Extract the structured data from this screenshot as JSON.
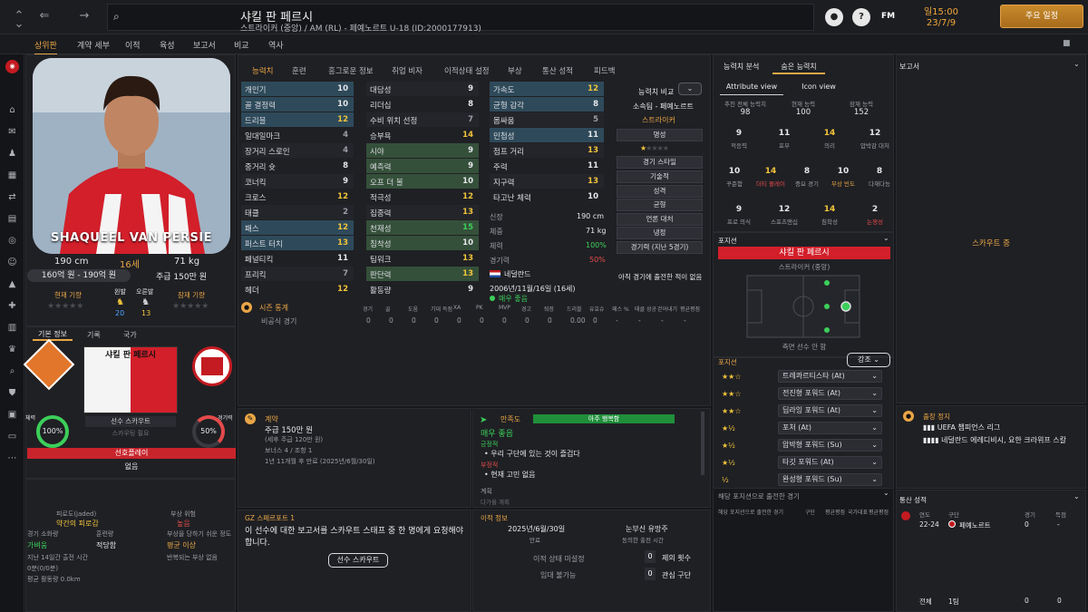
{
  "top": {
    "name": "샤킬 판 페르시",
    "sub": "스트라이커 (중앙) / AM (RL) - 페예노르트 U-18 (ID:2000177913)",
    "time": "일15:00",
    "date": "23/7/9",
    "main_btn": "주요 일정",
    "fm": "FM"
  },
  "menu": [
    "상위판",
    "계약 세부",
    "이적",
    "육성",
    "보고서",
    "비교",
    "역사"
  ],
  "player": {
    "photo_name": "SHAQUEEL VAN PERSIE",
    "height": "190 cm",
    "age": "16세",
    "weight": "71 kg",
    "value": "160억 원 - 190억 원",
    "wage": "주급 150만 원",
    "current_label": "현재 기량",
    "potential_label": "잠재 기량",
    "left_foot_label": "왼발",
    "right_foot_label": "오른발",
    "left_foot": "20",
    "right_foot": "13"
  },
  "left_tabs": [
    "기본 정보",
    "기록",
    "국가"
  ],
  "card": {
    "name": "샤킬 판 페르시",
    "scout_label": "선수 스카우트",
    "scout_needed": "스카우팅 필요",
    "fitness_label": "체력",
    "fitness": "100%",
    "sharp_label": "경기력",
    "sharp": "50%",
    "role_badge": "선호플레이",
    "role_none": "없음"
  },
  "left_bottom": {
    "jaded": "피로도(jaded)",
    "jaded_val": "약간의 피로감",
    "injury_risk": "부상 위험",
    "injury_val": "높음",
    "condition": "경기 소화량",
    "condition_val": "가벼움",
    "training": "훈련량",
    "training_val": "적당함",
    "injury_prone": "부상을 당하기 쉬운 정도",
    "injury_prone_val": "평균 이상",
    "mins14": "지난 14일간 출전 시간",
    "mins14_val": "0분(0/0분)",
    "avg_dist": "평균 활동량 0.0km",
    "repeat": "반복되는 부상 없음"
  },
  "attr_tabs": [
    "능력치",
    "훈련",
    "흥그로운 정보",
    "취업 비자",
    "이적상태 설정",
    "부상",
    "통산 성적",
    "피드백"
  ],
  "attrs": {
    "col1": [
      [
        "개인기",
        "10"
      ],
      [
        "골 결정력",
        "10"
      ],
      [
        "드리블",
        "12"
      ],
      [
        "일대일마크",
        "4"
      ],
      [
        "장거리 스로인",
        "4"
      ],
      [
        "중거리 슛",
        "8"
      ],
      [
        "코너킥",
        "9"
      ],
      [
        "크로스",
        "12"
      ],
      [
        "태클",
        "2"
      ],
      [
        "패스",
        "12"
      ],
      [
        "퍼스트 터치",
        "13"
      ],
      [
        "페널티킥",
        "11"
      ],
      [
        "프리킥",
        "7"
      ],
      [
        "헤더",
        "12"
      ]
    ],
    "col2": [
      [
        "대담성",
        "9"
      ],
      [
        "리더십",
        "8"
      ],
      [
        "수비 위치 선정",
        "7"
      ],
      [
        "승부욕",
        "14"
      ],
      [
        "시야",
        "9"
      ],
      [
        "예측력",
        "9"
      ],
      [
        "오프 더 볼",
        "10"
      ],
      [
        "적극성",
        "12"
      ],
      [
        "집중력",
        "13"
      ],
      [
        "천재성",
        "15"
      ],
      [
        "침착성",
        "10"
      ],
      [
        "팀워크",
        "13"
      ],
      [
        "판단력",
        "13"
      ],
      [
        "활동량",
        "9"
      ]
    ],
    "col3": [
      [
        "가속도",
        "12"
      ],
      [
        "균형 감각",
        "8"
      ],
      [
        "몸싸움",
        "5"
      ],
      [
        "민첩성",
        "11"
      ],
      [
        "점프 거리",
        "13"
      ],
      [
        "주력",
        "11"
      ],
      [
        "지구력",
        "13"
      ],
      [
        "타고난 체력",
        "10"
      ]
    ]
  },
  "physical": {
    "height_lbl": "신장",
    "height": "190 cm",
    "weight_lbl": "체중",
    "weight": "71 kg",
    "fitness_lbl": "체력",
    "fitness": "100%",
    "sharp_lbl": "경기력",
    "sharp": "50%",
    "nation_lbl": "국적",
    "nation": "네덜란드",
    "dob": "2006년/11월/16일 (16세)",
    "morale_lbl": "사기",
    "morale": "매우 좋음"
  },
  "compare": {
    "title": "능력치 비교",
    "club": "소속팀 - 페예노르트",
    "role": "스트라이커",
    "rep_btn": "명성",
    "style_btn": "경기 스타일",
    "tech_btn": "기술적",
    "mental_btn": "정신적",
    "phys_btn": "균형",
    "mental2_btn": "성격",
    "rec_btn": "언론 대처",
    "cool_btn": "냉정",
    "last5_btn": "경기력 (지난 5경기)",
    "none": "아직 경기에 출전한 적이 없음"
  },
  "season": {
    "title": "시즌 통계",
    "cols": [
      "경기",
      "골",
      "도움",
      "기대 득점",
      "XA",
      "PK",
      "MVP",
      "경고",
      "퇴장",
      "드리블",
      "유효슈",
      "패스 %",
      "태클 성공",
      "걷어내기",
      "평균평점"
    ],
    "row_label": "비공식 경기",
    "row_vals": [
      "0",
      "0",
      "0",
      "0",
      "0",
      "0",
      "0",
      "0",
      "0",
      "0.00",
      "0",
      "-",
      "-",
      "-",
      "-"
    ]
  },
  "contract": {
    "title": "계약",
    "wage": "주급 150만 원",
    "detail": "(세후 주급 120만 원)",
    "bonus": "보너스 4 / 조항 1",
    "expiry": "1년 11개월 후 만료 (2025년/6월/30일)"
  },
  "happiness": {
    "title": "만족도",
    "bar": "아주 행복함",
    "status": "매우 좋음",
    "pos_lbl": "긍정적",
    "pos": "우리 구단에 있는 것이 즐겁다",
    "neg_lbl": "부정적",
    "neg": "현재 고민 없음",
    "plan_lbl": "계획",
    "plan": "다가올 계획"
  },
  "scout_report": {
    "title": "스페르포트 1",
    "text": "이 선수에 대한 보고서를 스카우트 스태프 중 한 명에게 요청해야 합니다.",
    "btn": "선수 스카우트"
  },
  "transfer": {
    "title": "이적 정보",
    "date": "2025년/6월/30일",
    "date_lbl": "만료",
    "status": "눈부신 유망주",
    "status_lbl": "동의한 출전 시간",
    "transfer_status": "이적 상태 미설정",
    "loan_status": "임대 불가능",
    "offers_lbl": "제의 횟수",
    "offers": "0",
    "interest_lbl": "관심 구단",
    "interest": "0"
  },
  "analysis": {
    "tabs": [
      "능력치 분석",
      "숨은 능력치"
    ],
    "views": [
      "Attribute view",
      "Icon view"
    ],
    "ca_lbl": "추천 전체 능력치",
    "ca": "98",
    "cur_lbl": "현재 능력",
    "cur": "100",
    "pa_lbl": "잠재 능력",
    "pa": "152",
    "hidden": [
      [
        "9",
        "적응력"
      ],
      [
        "11",
        "포부"
      ],
      [
        "14",
        "의리"
      ],
      [
        "12",
        "압박감 대처"
      ],
      [
        "10",
        "꾸준함"
      ],
      [
        "14",
        "더티 플레이"
      ],
      [
        "8",
        "중요 경기"
      ],
      [
        "10",
        "부상 빈도"
      ],
      [
        "8",
        "다재다능"
      ],
      [
        "9",
        "프로 의식"
      ],
      [
        "12",
        "스포츠맨십"
      ],
      [
        "14",
        "침착성"
      ],
      [
        "2",
        "논쟁성"
      ]
    ]
  },
  "position": {
    "title": "포지션",
    "role": "샤킬 판 페르시",
    "role_sub": "스트라이커 (중앙)",
    "caption": "측면 선수 안 함"
  },
  "roles": {
    "title": "포지션",
    "emph": "강조",
    "list": [
      [
        "★★☆",
        "트레콰르티스타 (At)"
      ],
      [
        "★★☆",
        "전진형 포워드 (At)"
      ],
      [
        "★★☆",
        "딥라잉 포워드 (At)"
      ],
      [
        "★½",
        "포처 (At)"
      ],
      [
        "★½",
        "압박형 포워드 (Su)"
      ],
      [
        "★½",
        "타깃 포워드 (At)"
      ],
      [
        "½",
        "완성형 포워드 (Su)"
      ]
    ],
    "played": "해당 포지션으로 출전한 경기",
    "played_cols": [
      "해당 포지션으로 출전한 경기",
      "구단",
      "평균평점",
      "국가대표",
      "평균평점"
    ]
  },
  "report": {
    "title": "보고서",
    "status": "스카우트 중"
  },
  "trips": {
    "title": "출장 정지",
    "a": "UEFA 챔피언스 리그",
    "b": "네덜란드 에레디비시, 요한 크라위프 스칼"
  },
  "career": {
    "title": "통산 성적",
    "cols": [
      "연도",
      "구단",
      "경기",
      "득점"
    ],
    "row": [
      "22-24",
      "페예노르트",
      "0",
      "-"
    ],
    "total_lbl": "전체",
    "total_club": "1팀",
    "total_apps": "0",
    "total_goals": "0"
  },
  "colors": {
    "accent": "#e9a646",
    "green": "#3ccf5a",
    "yellow": "#f2c43b",
    "red": "#e44a4a"
  }
}
